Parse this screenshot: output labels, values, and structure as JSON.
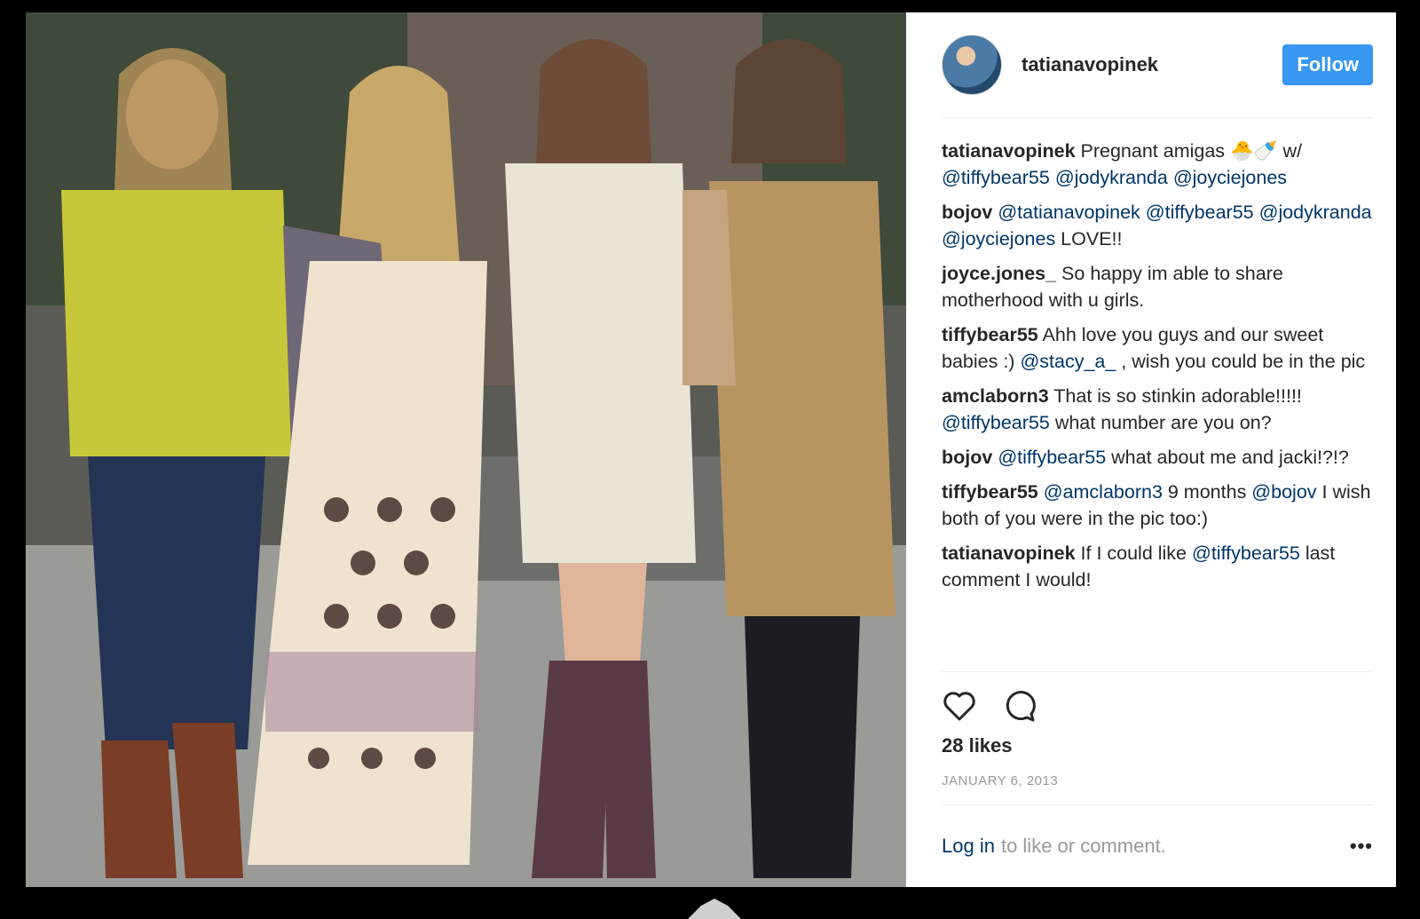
{
  "post": {
    "username": "tatianavopinek",
    "follow_label": "Follow",
    "comments": [
      {
        "author": "tatianavopinek",
        "parts": [
          {
            "t": " Pregnant amigas 🐣🍼 w/ "
          },
          {
            "m": "@tiffybear55"
          },
          {
            "t": " "
          },
          {
            "m": "@jodykranda"
          },
          {
            "t": " "
          },
          {
            "m": "@joyciejones"
          }
        ]
      },
      {
        "author": "bojov",
        "parts": [
          {
            "t": " "
          },
          {
            "m": "@tatianavopinek"
          },
          {
            "t": " "
          },
          {
            "m": "@tiffybear55"
          },
          {
            "t": " "
          },
          {
            "m": "@jodykranda"
          },
          {
            "t": " "
          },
          {
            "m": "@joyciejones"
          },
          {
            "t": " LOVE!!"
          }
        ]
      },
      {
        "author": "joyce.jones_",
        "parts": [
          {
            "t": " So happy im able to share motherhood with u girls."
          }
        ]
      },
      {
        "author": "tiffybear55",
        "parts": [
          {
            "t": " Ahh love you guys and our sweet babies :) "
          },
          {
            "m": "@stacy_a_"
          },
          {
            "t": " , wish you could be in the pic"
          }
        ]
      },
      {
        "author": "amclaborn3",
        "parts": [
          {
            "t": " That is so stinkin adorable!!!!! "
          },
          {
            "m": "@tiffybear55"
          },
          {
            "t": " what number are you on?"
          }
        ]
      },
      {
        "author": "bojov",
        "parts": [
          {
            "t": " "
          },
          {
            "m": "@tiffybear55"
          },
          {
            "t": " what about me and jacki!?!?"
          }
        ]
      },
      {
        "author": "tiffybear55",
        "parts": [
          {
            "t": " "
          },
          {
            "m": "@amclaborn3"
          },
          {
            "t": " 9 months "
          },
          {
            "m": "@bojov"
          },
          {
            "t": " I wish both of you were in the pic too:)"
          }
        ]
      },
      {
        "author": "tatianavopinek",
        "parts": [
          {
            "t": " If I could like "
          },
          {
            "m": "@tiffybear55"
          },
          {
            "t": " last comment I would!"
          }
        ]
      }
    ],
    "likes": "28 likes",
    "date": "JANUARY 6, 2013",
    "login_link": "Log in",
    "login_rest": "to like or comment.",
    "more": "•••",
    "icons": {
      "like": "heart-icon",
      "comment": "comment-bubble-icon",
      "more": "more-options-icon"
    },
    "colors": {
      "follow_bg": "#3897f0",
      "mention": "#003569",
      "muted": "#999999"
    }
  }
}
